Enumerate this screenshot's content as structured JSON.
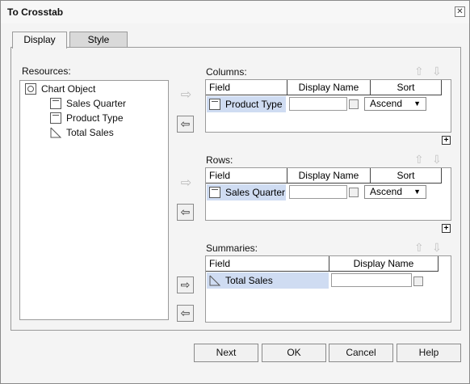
{
  "window": {
    "title": "To Crosstab",
    "close_glyph": "✕"
  },
  "tabs": [
    {
      "label": "Display",
      "active": true
    },
    {
      "label": "Style",
      "active": false
    }
  ],
  "resources": {
    "label": "Resources:",
    "root": "Chart Object",
    "items": [
      "Sales Quarter",
      "Product Type",
      "Total Sales"
    ]
  },
  "arrows": {
    "add": "⇨",
    "remove": "⇦"
  },
  "columns": {
    "label": "Columns:",
    "headers": {
      "field": "Field",
      "display_name": "Display Name",
      "sort": "Sort"
    },
    "rows": [
      {
        "field": "Product Type",
        "display_name": "",
        "sort": "Ascend"
      }
    ]
  },
  "rows_section": {
    "label": "Rows:",
    "headers": {
      "field": "Field",
      "display_name": "Display Name",
      "sort": "Sort"
    },
    "rows": [
      {
        "field": "Sales Quarter",
        "display_name": "",
        "sort": "Ascend"
      }
    ]
  },
  "summaries": {
    "label": "Summaries:",
    "headers": {
      "field": "Field",
      "display_name": "Display Name"
    },
    "rows": [
      {
        "field": "Total Sales",
        "display_name": ""
      }
    ]
  },
  "buttons": {
    "next": "Next",
    "ok": "OK",
    "cancel": "Cancel",
    "help": "Help"
  },
  "icons": {
    "up": "⇧",
    "down": "⇩",
    "plus": "+",
    "dropdown": "▼"
  }
}
